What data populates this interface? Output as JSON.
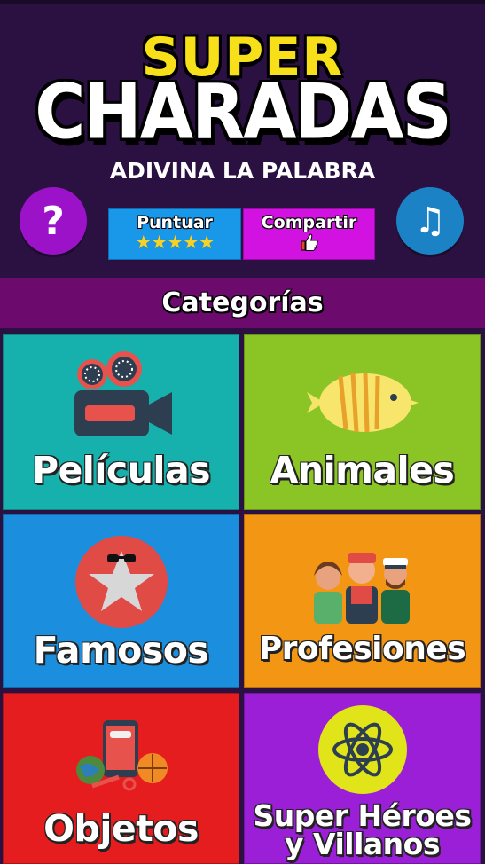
{
  "logo": {
    "line1": "SUPER",
    "line2": "CHARADAS"
  },
  "subtitle": "ADIVINA LA PALABRA",
  "buttons": {
    "help": "?",
    "rate_label": "Puntuar",
    "rate_stars": "★★★★★",
    "share_label": "Compartir",
    "music": "♫"
  },
  "header": {
    "title": "Categorías"
  },
  "categories": [
    {
      "label": "Películas",
      "color": "#16b1ac",
      "icon": "movie-camera-icon"
    },
    {
      "label": "Animales",
      "color": "#8bc425",
      "icon": "fish-icon"
    },
    {
      "label": "Famosos",
      "color": "#1b8ede",
      "icon": "star-sunglasses-icon"
    },
    {
      "label": "Profesiones",
      "color": "#f39614",
      "icon": "workers-icon"
    },
    {
      "label": "Objetos",
      "color": "#e51d1e",
      "icon": "objects-icon"
    },
    {
      "label_line1": "Super Héroes",
      "label_line2": "y Villanos",
      "color": "#9a1fd7",
      "icon": "atom-icon"
    }
  ]
}
